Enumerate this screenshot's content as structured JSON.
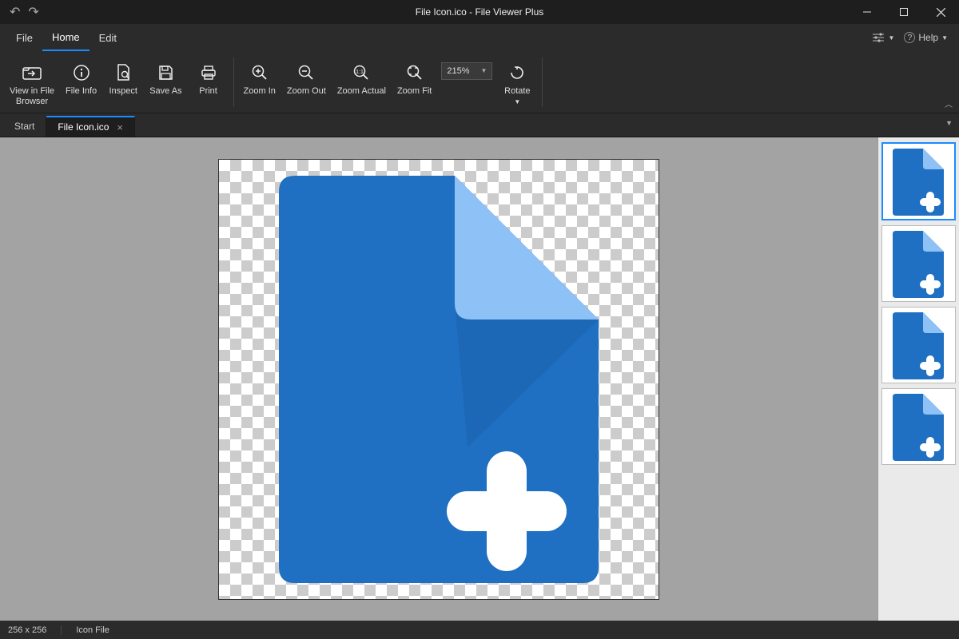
{
  "title": "File Icon.ico - File Viewer Plus",
  "menus": {
    "file": "File",
    "home": "Home",
    "edit": "Edit",
    "help": "Help"
  },
  "ribbon": {
    "view_in_file_browser": "View in File\nBrowser",
    "file_info": "File Info",
    "inspect": "Inspect",
    "save_as": "Save As",
    "print": "Print",
    "zoom_in": "Zoom In",
    "zoom_out": "Zoom Out",
    "zoom_actual": "Zoom Actual",
    "zoom_fit": "Zoom Fit",
    "zoom_value": "215%",
    "rotate": "Rotate"
  },
  "tabs": {
    "start": "Start",
    "file": "File Icon.ico"
  },
  "status": {
    "dimensions": "256 x 256",
    "type": "Icon File"
  }
}
